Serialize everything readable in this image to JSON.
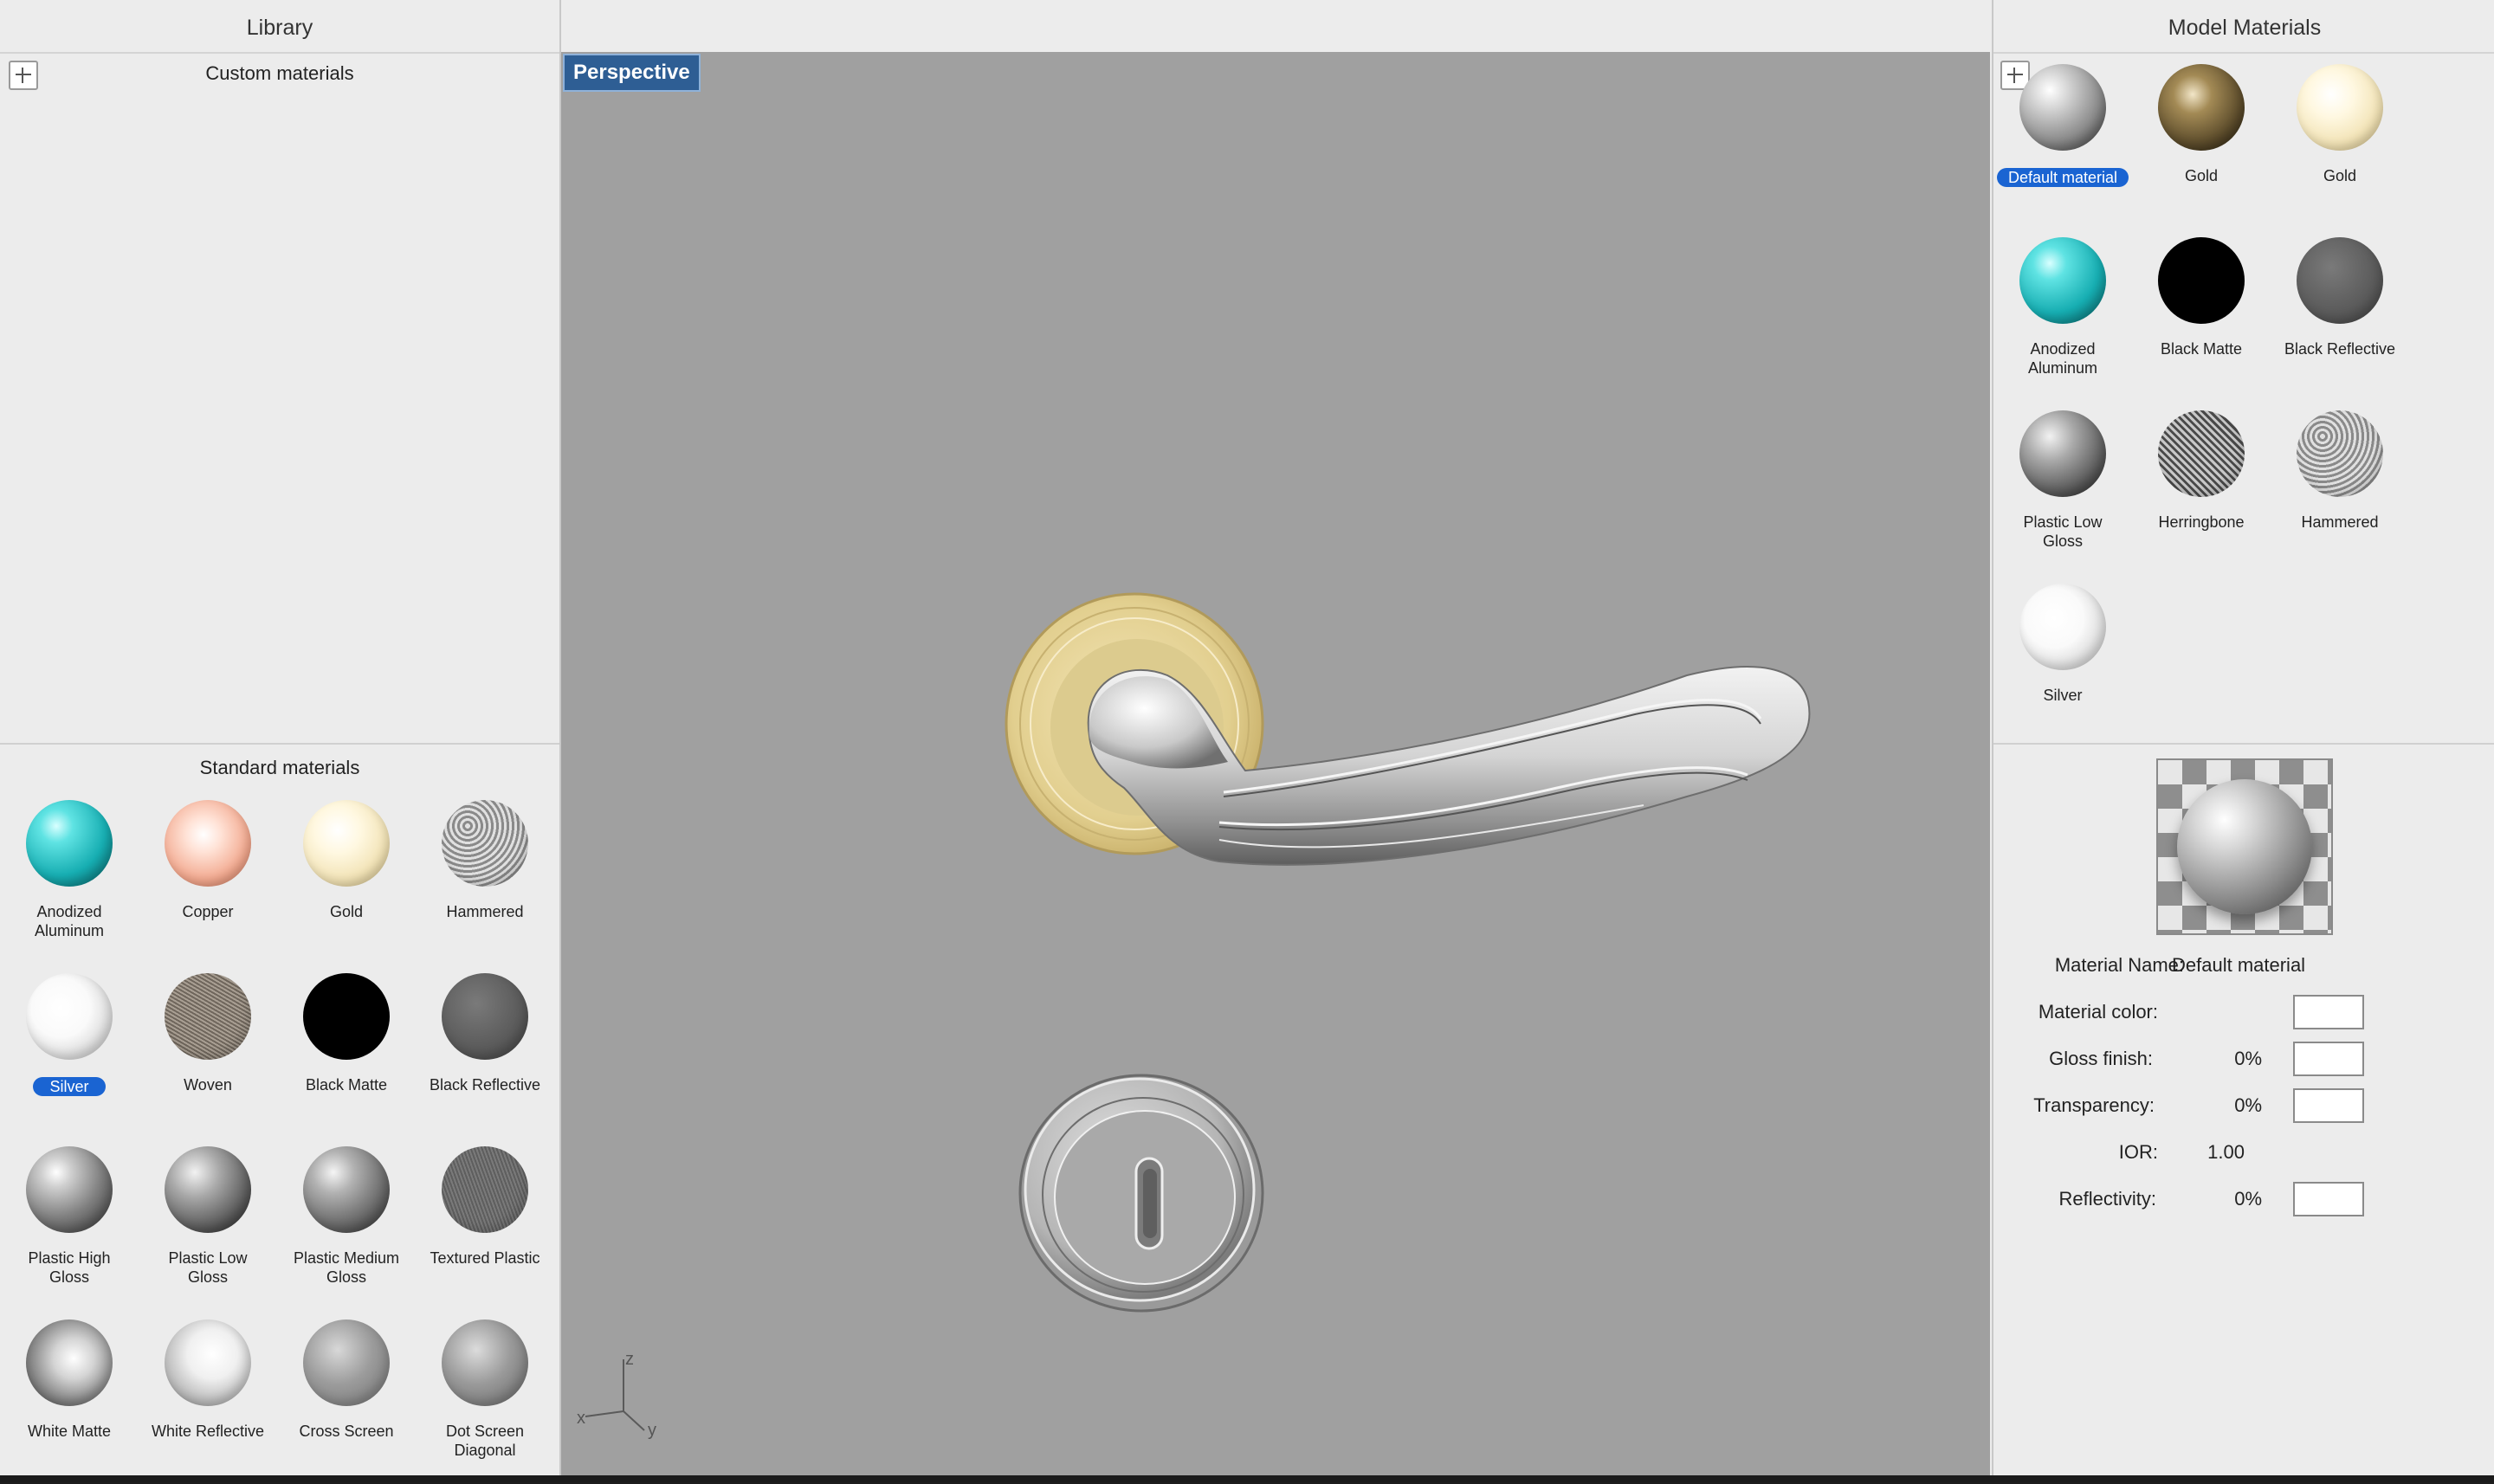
{
  "library": {
    "title": "Library",
    "custom_title": "Custom materials",
    "standard_title": "Standard materials",
    "standard_items": [
      {
        "label": "Anodized\nAluminum",
        "icon": "anodized-aluminum-ball"
      },
      {
        "label": "Copper",
        "icon": "copper-ball"
      },
      {
        "label": "Gold",
        "icon": "gold-ball"
      },
      {
        "label": "Hammered",
        "icon": "hammered-ball"
      },
      {
        "label": "Silver",
        "icon": "silver-ball",
        "selected": true
      },
      {
        "label": "Woven",
        "icon": "woven-ball"
      },
      {
        "label": "Black Matte",
        "icon": "black-matte-ball"
      },
      {
        "label": "Black Reflective",
        "icon": "black-reflective-ball"
      },
      {
        "label": "Plastic High\nGloss",
        "icon": "plastic-high-gloss-ball"
      },
      {
        "label": "Plastic Low\nGloss",
        "icon": "plastic-low-gloss-ball"
      },
      {
        "label": "Plastic Medium\nGloss",
        "icon": "plastic-medium-gloss-ball"
      },
      {
        "label": "Textured Plastic",
        "icon": "textured-plastic-ball"
      },
      {
        "label": "White Matte",
        "icon": "white-matte-ball"
      },
      {
        "label": "White Reflective",
        "icon": "white-reflective-ball"
      },
      {
        "label": "Cross Screen",
        "icon": "cross-screen-ball"
      },
      {
        "label": "Dot Screen\nDiagonal",
        "icon": "dot-screen-diagonal-ball"
      }
    ]
  },
  "viewport": {
    "label": "Perspective",
    "axes": {
      "z": "z",
      "x": "x",
      "y": "y"
    }
  },
  "model_materials": {
    "title": "Model Materials",
    "items": [
      {
        "label": "Default material",
        "icon": "default-material-ball",
        "selected": true
      },
      {
        "label": "Gold",
        "icon": "dark-gold-ball"
      },
      {
        "label": "Gold",
        "icon": "gold-ball"
      },
      {
        "label": "Anodized\nAluminum",
        "icon": "anodized-aluminum-ball"
      },
      {
        "label": "Black Matte",
        "icon": "black-matte-ball"
      },
      {
        "label": "Black Reflective",
        "icon": "black-reflective-ball"
      },
      {
        "label": "Plastic Low\nGloss",
        "icon": "plastic-low-gloss-ball"
      },
      {
        "label": "Herringbone",
        "icon": "herringbone-ball"
      },
      {
        "label": "Hammered",
        "icon": "hammered-ball"
      },
      {
        "label": "Silver",
        "icon": "silver-ball"
      }
    ]
  },
  "properties": {
    "name_label": "Material Name:",
    "name_value": "Default material",
    "color_label": "Material color:",
    "gloss_label": "Gloss finish:",
    "gloss_value": "0%",
    "transparency_label": "Transparency:",
    "transparency_value": "0%",
    "ior_label": "IOR:",
    "ior_value": "1.00",
    "reflectivity_label": "Reflectivity:",
    "reflectivity_value": "0%"
  },
  "colors": {
    "selection": "#1a64d2",
    "viewport_bg": "#a0a0a0",
    "viewport_label_bg": "#2e5e94"
  }
}
